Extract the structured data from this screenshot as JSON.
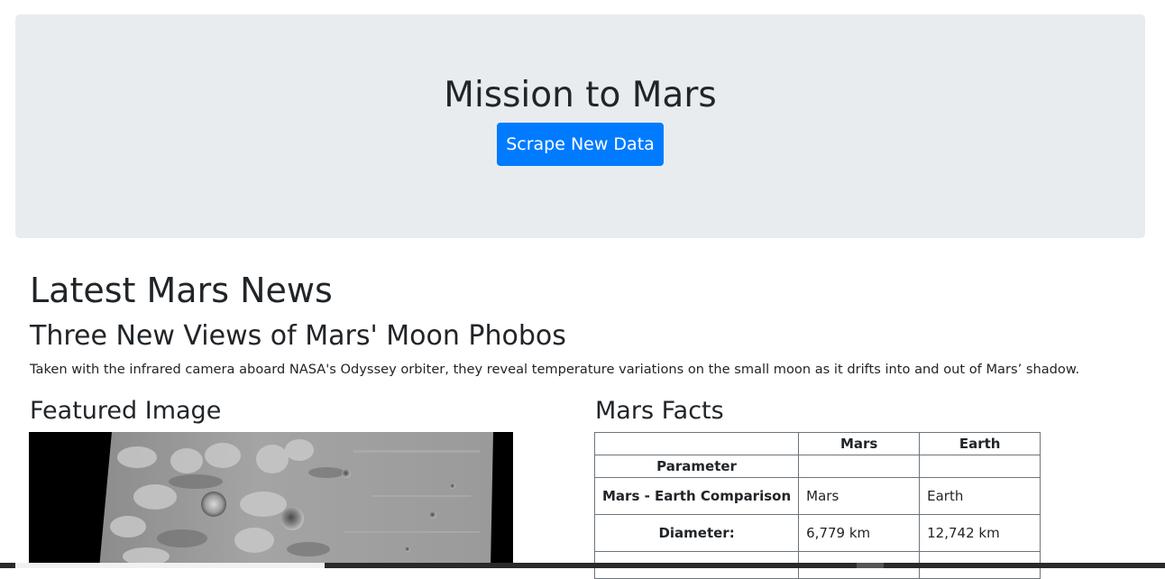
{
  "header": {
    "title": "Mission to Mars",
    "scrape_button_label": "Scrape New Data",
    "background_color": "#e9ecef",
    "button_color": "#007bff"
  },
  "news": {
    "section_heading": "Latest Mars News",
    "title": "Three New Views of Mars' Moon Phobos",
    "paragraph": "Taken with the infrared camera aboard NASA's Odyssey orbiter, they reveal temperature variations on the small moon as it drifts into and out of Mars’ shadow."
  },
  "featured": {
    "heading": "Featured Image"
  },
  "facts": {
    "heading": "Mars Facts",
    "columns": [
      "",
      "Mars",
      "Earth"
    ],
    "index_name": "Parameter",
    "rows": [
      {
        "label": "Mars - Earth Comparison",
        "mars": "Mars",
        "earth": "Earth"
      },
      {
        "label": "Diameter:",
        "mars": "6,779 km",
        "earth": "12,742 km"
      }
    ]
  }
}
